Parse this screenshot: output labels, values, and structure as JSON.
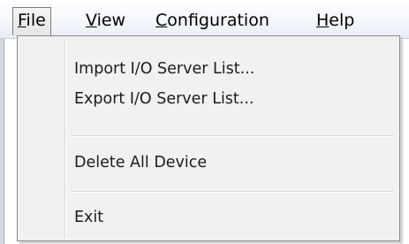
{
  "menubar": {
    "items": [
      {
        "key": "file",
        "prefix": "",
        "mnemonic": "F",
        "rest": "ile"
      },
      {
        "key": "view",
        "prefix": "",
        "mnemonic": "V",
        "rest": "iew"
      },
      {
        "key": "config",
        "prefix": "",
        "mnemonic": "C",
        "rest": "onfiguration"
      },
      {
        "key": "help",
        "prefix": "",
        "mnemonic": "H",
        "rest": "elp"
      }
    ],
    "active": "file"
  },
  "file_menu": {
    "import_label": "Import I/O Server List...",
    "export_label": "Export I/O Server List...",
    "delete_label": "Delete All Device",
    "exit_label": "Exit"
  }
}
